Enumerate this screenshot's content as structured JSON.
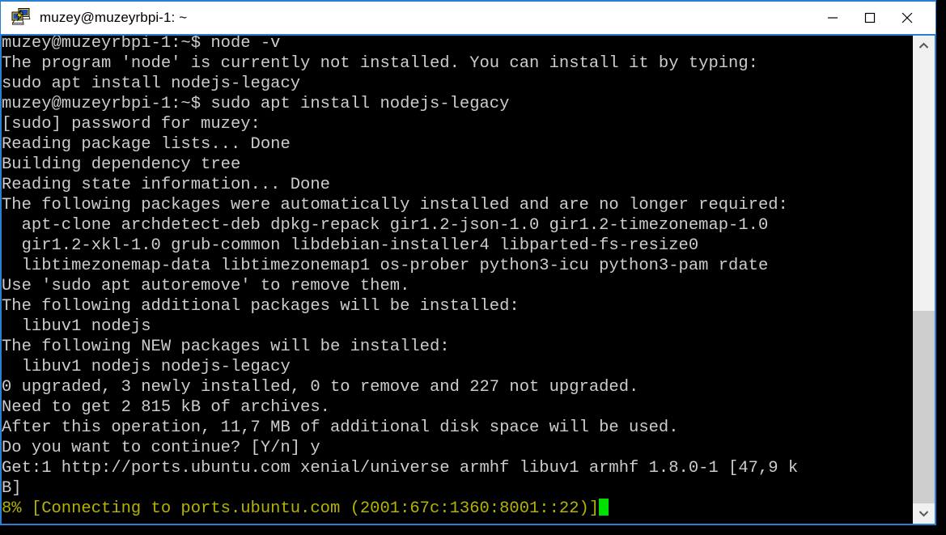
{
  "window": {
    "title": "muzey@muzeyrbpi-1: ~",
    "icon": "putty-terminal-icon",
    "accent_color": "#2a7fd4",
    "titlebar_bg": "#ffffff",
    "controls": [
      {
        "name": "minimize",
        "glyph": "—"
      },
      {
        "name": "maximize",
        "glyph": "▢"
      },
      {
        "name": "close",
        "glyph": "✕"
      }
    ]
  },
  "terminal": {
    "background_color": "#000000",
    "foreground_color": "#cccccc",
    "progress_color": "#b4b400",
    "cursor_color": "#00e000",
    "font_size_px": 20.5,
    "line_height_px": 25,
    "lines": [
      {
        "text": "muzey@muzeyrbpi-1:~$ node -v",
        "color": "default"
      },
      {
        "text": "The program 'node' is currently not installed. You can install it by typing:",
        "color": "default"
      },
      {
        "text": "sudo apt install nodejs-legacy",
        "color": "default"
      },
      {
        "text": "muzey@muzeyrbpi-1:~$ sudo apt install nodejs-legacy",
        "color": "default"
      },
      {
        "text": "[sudo] password for muzey:",
        "color": "default"
      },
      {
        "text": "Reading package lists... Done",
        "color": "default"
      },
      {
        "text": "Building dependency tree",
        "color": "default"
      },
      {
        "text": "Reading state information... Done",
        "color": "default"
      },
      {
        "text": "The following packages were automatically installed and are no longer required:",
        "color": "default"
      },
      {
        "text": "  apt-clone archdetect-deb dpkg-repack gir1.2-json-1.0 gir1.2-timezonemap-1.0",
        "color": "default"
      },
      {
        "text": "  gir1.2-xkl-1.0 grub-common libdebian-installer4 libparted-fs-resize0",
        "color": "default"
      },
      {
        "text": "  libtimezonemap-data libtimezonemap1 os-prober python3-icu python3-pam rdate",
        "color": "default"
      },
      {
        "text": "Use 'sudo apt autoremove' to remove them.",
        "color": "default"
      },
      {
        "text": "The following additional packages will be installed:",
        "color": "default"
      },
      {
        "text": "  libuv1 nodejs",
        "color": "default"
      },
      {
        "text": "The following NEW packages will be installed:",
        "color": "default"
      },
      {
        "text": "  libuv1 nodejs nodejs-legacy",
        "color": "default"
      },
      {
        "text": "0 upgraded, 3 newly installed, 0 to remove and 227 not upgraded.",
        "color": "default"
      },
      {
        "text": "Need to get 2 815 kB of archives.",
        "color": "default"
      },
      {
        "text": "After this operation, 11,7 MB of additional disk space will be used.",
        "color": "default"
      },
      {
        "text": "Do you want to continue? [Y/n] y",
        "color": "default"
      },
      {
        "text": "Get:1 http://ports.ubuntu.com xenial/universe armhf libuv1 armhf 1.8.0-1 [47,9 k",
        "color": "default"
      },
      {
        "text": "B]",
        "color": "default"
      },
      {
        "text": "8% [Connecting to ports.ubuntu.com (2001:67c:1360:8001::22)]",
        "color": "progress"
      }
    ],
    "progress_percent": "8%",
    "cursor_visible": true
  },
  "scrollbar": {
    "up_arrow": "chevron-up",
    "down_arrow": "chevron-down",
    "thumb_position_percent": 57,
    "track_color": "#f0f0f0",
    "thumb_color": "#cdcdcd"
  }
}
